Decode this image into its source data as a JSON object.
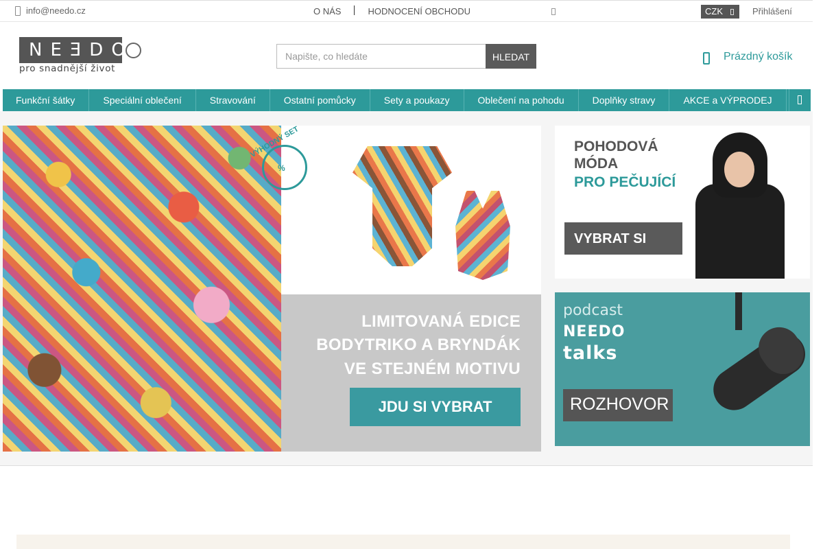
{
  "topbar": {
    "email": "info@needo.cz",
    "links": [
      "O NÁS",
      "HODNOCENÍ OBCHODU"
    ],
    "currency": "CZK",
    "login": "Přihlášení"
  },
  "header": {
    "logo_text": "NEƎDO",
    "tagline": "pro snadnější život",
    "search_placeholder": "Napište, co hledáte",
    "search_button": "HLEDAT",
    "cart_label": "Prázdný košík"
  },
  "nav": {
    "items": [
      "Funkční šátky",
      "Speciální oblečení",
      "Stravování",
      "Ostatní pomůcky",
      "Sety a poukazy",
      "Oblečení na pohodu",
      "Doplňky stravy",
      "AKCE a VÝPRODEJ"
    ]
  },
  "banners": {
    "main": {
      "badge_text": "VÝHODNÝ SET",
      "badge_symbol": "%",
      "line1": "LIMITOVANÁ EDICE",
      "line2": "BODYTRIKO A BRYNDÁK",
      "line3": "VE STEJNÉM MOTIVU",
      "cta": "JDU SI VYBRAT"
    },
    "side1": {
      "line1": "POHODOVÁ",
      "line2": "MÓDA",
      "line3": "PRO PEČUJÍCÍ",
      "cta": "VYBRAT SI"
    },
    "side2": {
      "line1": "podcast",
      "line2": "NEEDO",
      "line3": "talks",
      "cta": "ROZHOVOR"
    }
  },
  "colors": {
    "accent": "#2d9a9a",
    "dark": "#555555"
  }
}
